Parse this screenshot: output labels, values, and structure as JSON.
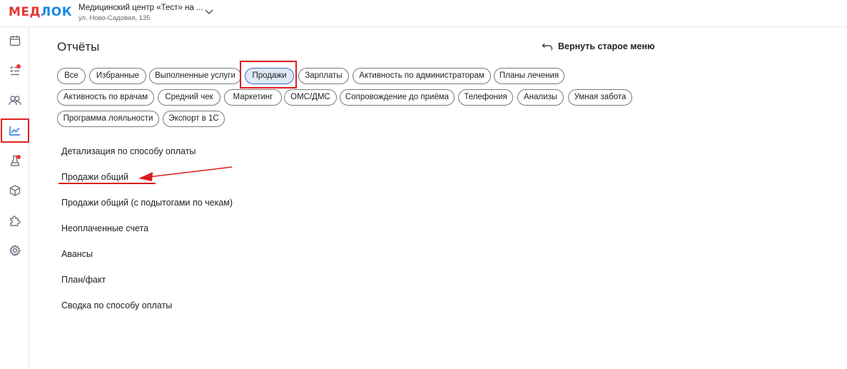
{
  "brand": {
    "logo_part1": "МЕД",
    "logo_part2": "ЛОК"
  },
  "clinic": {
    "name": "Медицинский центр «Тест» на ...",
    "address": "ул. Ново-Садовая, 135"
  },
  "sidebar": {
    "items": [
      {
        "icon": "calendar-icon"
      },
      {
        "icon": "tasks-icon",
        "badge": true
      },
      {
        "icon": "patients-icon"
      },
      {
        "icon": "reports-chart-icon",
        "active": true
      },
      {
        "icon": "lab-flask-icon",
        "badge": true
      },
      {
        "icon": "box-icon"
      },
      {
        "icon": "puzzle-icon"
      },
      {
        "icon": "settings-gear-icon"
      }
    ]
  },
  "page": {
    "title": "Отчёты",
    "old_menu_label": "Вернуть старое меню"
  },
  "chips": [
    "Все",
    "Избранные",
    "Выполненные услуги",
    "Продажи",
    "Зарплаты",
    "Активность по администраторам",
    "Планы лечения",
    "Активность по врачам",
    "Средний чек",
    "Маркетинг",
    "ОМС/ДМС",
    "Сопровождение до приёма",
    "Телефония",
    "Анализы",
    "Умная забота",
    "Программа лояльности",
    "Экспорт в 1С"
  ],
  "selected_chip": "Продажи",
  "reports": [
    "Детализация по способу оплаты",
    "Продажи общий",
    "Продажи общий (с подытогами по чекам)",
    "Неоплаченные счета",
    "Авансы",
    "План/факт",
    "Сводка по способу оплаты"
  ],
  "colors": {
    "accent": "#1e6fd9",
    "annotation": "#d81e1e",
    "selected_chip_bg": "#dfe9f7"
  }
}
